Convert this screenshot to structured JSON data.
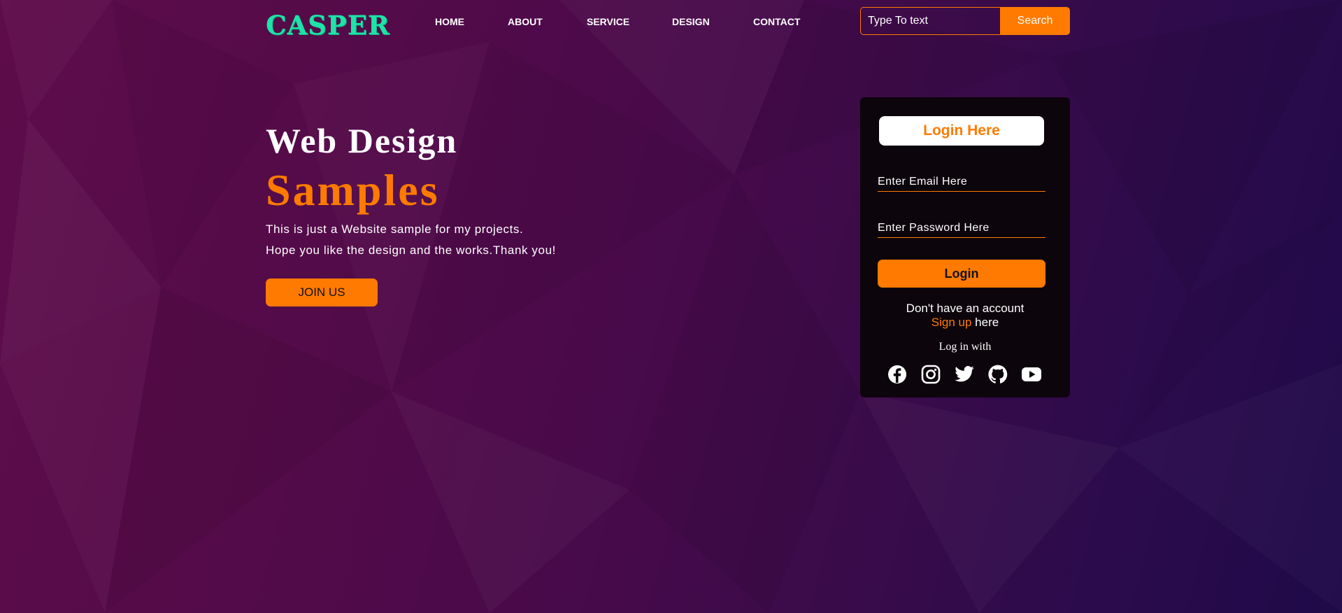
{
  "brand": {
    "logo_text": "CASPER"
  },
  "nav": {
    "items": [
      {
        "label": "HOME"
      },
      {
        "label": "ABOUT"
      },
      {
        "label": "SERVICE"
      },
      {
        "label": "DESIGN"
      },
      {
        "label": "CONTACT"
      }
    ]
  },
  "search": {
    "placeholder": "Type To text",
    "button_label": "Search"
  },
  "hero": {
    "title": "Web Design",
    "subtitle": "Samples",
    "line1": "This is just a Website sample for my projects.",
    "line2": "Hope you like the design and the works.Thank you!",
    "cta_label": "JOIN US"
  },
  "login": {
    "heading": "Login Here",
    "email_placeholder": "Enter Email Here",
    "password_placeholder": "Enter Password Here",
    "button_label": "Login",
    "no_account_text": "Don't have an account",
    "signup_link": "Sign up",
    "signup_suffix": " here",
    "login_with": "Log in with",
    "social_icons": [
      "facebook-icon",
      "instagram-icon",
      "twitter-icon",
      "github-icon",
      "youtube-icon"
    ]
  },
  "colors": {
    "accent": "#ff7a00",
    "logo": "#1ee3a8",
    "card_bg": "#0d050c",
    "background_start": "#5e0c4a",
    "background_end": "#1f0a48"
  }
}
